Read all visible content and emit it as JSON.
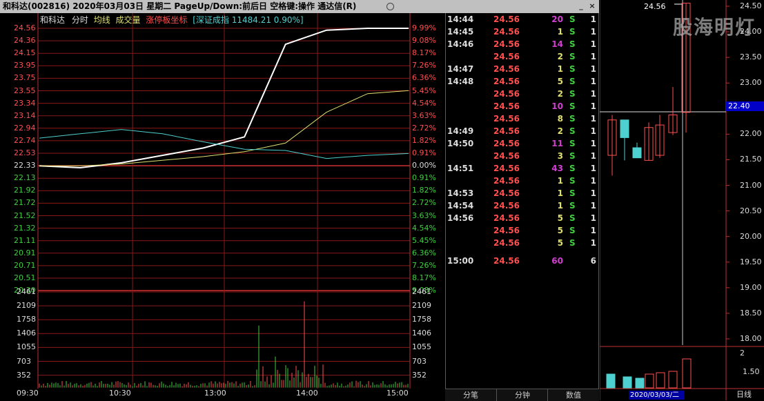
{
  "window": {
    "title": "和科达(002816)  2020年03月03日  星期二  PageUp/Down:前后日  空格键:操作  通达信(R)",
    "btn_min": "_",
    "btn_close": "×"
  },
  "legend": {
    "name": "和科达",
    "tab_fenshi": "分时",
    "avg": "均线",
    "vol": "成交量",
    "limit_axis": "涨停板坐标",
    "index": "[深证成指 11484.21 0.90%]"
  },
  "price_axis": {
    "left": [
      "24.56",
      "24.36",
      "24.15",
      "23.95",
      "23.75",
      "23.55",
      "23.34",
      "23.14",
      "22.94",
      "22.74",
      "22.53",
      "22.33",
      "22.13",
      "21.92",
      "21.72",
      "21.52",
      "21.32",
      "21.11",
      "20.91",
      "20.71",
      "20.51",
      "20.30"
    ],
    "right": [
      "9.99%",
      "9.08%",
      "8.17%",
      "7.26%",
      "6.36%",
      "5.45%",
      "4.54%",
      "3.63%",
      "2.72%",
      "1.82%",
      "0.91%",
      "0.00%",
      "0.91%",
      "1.82%",
      "2.72%",
      "3.63%",
      "4.54%",
      "5.45%",
      "6.36%",
      "7.26%",
      "8.17%",
      "9.08%"
    ]
  },
  "volume_axis": {
    "left": [
      "2461",
      "2109",
      "1758",
      "1406",
      "1055",
      "703",
      "352"
    ],
    "right": [
      "2461",
      "2109",
      "1758",
      "1406",
      "1055",
      "703",
      "352"
    ]
  },
  "time_axis": [
    "09:30",
    "10:30",
    "13:00",
    "14:00",
    "15:00"
  ],
  "chart_data": {
    "type": "line",
    "prev_close": 22.33,
    "y_range": [
      20.1,
      24.56
    ],
    "x": [
      "09:30",
      "10:00",
      "10:30",
      "11:00",
      "11:30/13:00",
      "13:30",
      "13:45",
      "14:00",
      "14:30",
      "15:00"
    ],
    "series": [
      {
        "color": "#ffffff",
        "values": [
          22.33,
          22.3,
          22.38,
          22.5,
          22.62,
          22.8,
          24.3,
          24.53,
          24.56,
          24.56
        ]
      },
      {
        "color": "#e0e070",
        "values": [
          22.33,
          22.33,
          22.36,
          22.42,
          22.48,
          22.56,
          22.7,
          23.2,
          23.5,
          23.55
        ]
      },
      {
        "color": "#4fd0d0",
        "values": [
          22.78,
          22.85,
          22.92,
          22.85,
          22.72,
          22.6,
          22.58,
          22.45,
          22.5,
          22.53
        ]
      }
    ]
  },
  "tape": [
    {
      "time": "14:44",
      "price": "24.56",
      "vol": "20",
      "vc": "#d040d0",
      "bs": "S",
      "n": "1"
    },
    {
      "time": "14:45",
      "price": "24.56",
      "vol": "1",
      "vc": "#e0e070",
      "bs": "S",
      "n": "1"
    },
    {
      "time": "14:46",
      "price": "24.56",
      "vol": "14",
      "vc": "#d040d0",
      "bs": "S",
      "n": "1"
    },
    {
      "time": "",
      "price": "24.56",
      "vol": "2",
      "vc": "#e0e070",
      "bs": "S",
      "n": "1"
    },
    {
      "time": "14:47",
      "price": "24.56",
      "vol": "1",
      "vc": "#e0e070",
      "bs": "S",
      "n": "1"
    },
    {
      "time": "14:48",
      "price": "24.56",
      "vol": "5",
      "vc": "#e0e070",
      "bs": "S",
      "n": "1"
    },
    {
      "time": "",
      "price": "24.56",
      "vol": "2",
      "vc": "#e0e070",
      "bs": "S",
      "n": "1"
    },
    {
      "time": "",
      "price": "24.56",
      "vol": "10",
      "vc": "#d040d0",
      "bs": "S",
      "n": "1"
    },
    {
      "time": "",
      "price": "24.56",
      "vol": "8",
      "vc": "#e0e070",
      "bs": "S",
      "n": "1"
    },
    {
      "time": "14:49",
      "price": "24.56",
      "vol": "2",
      "vc": "#e0e070",
      "bs": "S",
      "n": "1"
    },
    {
      "time": "14:50",
      "price": "24.56",
      "vol": "11",
      "vc": "#d040d0",
      "bs": "S",
      "n": "1"
    },
    {
      "time": "",
      "price": "24.56",
      "vol": "3",
      "vc": "#e0e070",
      "bs": "S",
      "n": "1"
    },
    {
      "time": "14:51",
      "price": "24.56",
      "vol": "43",
      "vc": "#d040d0",
      "bs": "S",
      "n": "1"
    },
    {
      "time": "",
      "price": "24.56",
      "vol": "1",
      "vc": "#e0e070",
      "bs": "S",
      "n": "1"
    },
    {
      "time": "14:53",
      "price": "24.56",
      "vol": "1",
      "vc": "#e0e070",
      "bs": "S",
      "n": "1"
    },
    {
      "time": "14:54",
      "price": "24.56",
      "vol": "1",
      "vc": "#e0e070",
      "bs": "S",
      "n": "1"
    },
    {
      "time": "14:56",
      "price": "24.56",
      "vol": "5",
      "vc": "#e0e070",
      "bs": "S",
      "n": "1"
    },
    {
      "time": "",
      "price": "24.56",
      "vol": "5",
      "vc": "#e0e070",
      "bs": "S",
      "n": "1"
    },
    {
      "time": "",
      "price": "24.56",
      "vol": "5",
      "vc": "#e0e070",
      "bs": "S",
      "n": "1"
    },
    {
      "time": "15:00",
      "price": "24.56",
      "vol": "60",
      "vc": "#d040d0",
      "bs": "",
      "n": "6"
    }
  ],
  "tabs": [
    "分笔",
    "分钟",
    "数值"
  ],
  "kline": {
    "watermark": "股海明灯",
    "high_label": "24.56",
    "current_label": "22.40",
    "axis": [
      "24.50",
      "24.00",
      "23.50",
      "23.00",
      "22.50",
      "22.00",
      "21.50",
      "21.00",
      "20.50",
      "20.00",
      "19.50",
      "19.00",
      "18.50",
      "18.00"
    ],
    "vol_axis": [
      "2",
      "1.50"
    ],
    "date": "2020/03/03/二",
    "period": "日线"
  }
}
